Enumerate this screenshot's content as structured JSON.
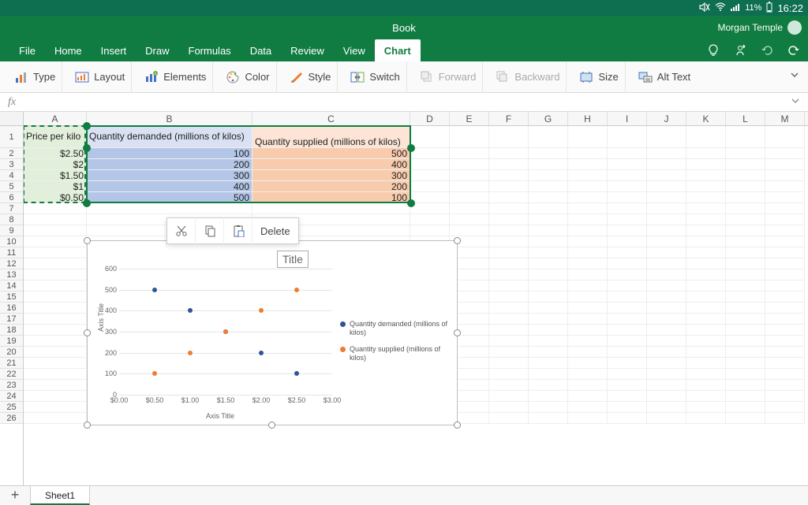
{
  "status": {
    "battery": "11%",
    "time": "16:22"
  },
  "titlebar": {
    "title": "Book",
    "user": "Morgan Temple"
  },
  "tabs": {
    "file": "File",
    "home": "Home",
    "insert": "Insert",
    "draw": "Draw",
    "formulas": "Formulas",
    "data": "Data",
    "review": "Review",
    "view": "View",
    "chart": "Chart"
  },
  "ribbon": {
    "type": "Type",
    "layout": "Layout",
    "elements": "Elements",
    "color": "Color",
    "style": "Style",
    "switch": "Switch",
    "forward": "Forward",
    "backward": "Backward",
    "size": "Size",
    "alttext": "Alt Text"
  },
  "columns": [
    "A",
    "B",
    "C",
    "D",
    "E",
    "F",
    "G",
    "H",
    "I",
    "J",
    "K",
    "L",
    "M"
  ],
  "sheet": {
    "header_row": {
      "A": "Price per kilo",
      "B": "Quantity demanded (millions of kilos)",
      "C": "Quantity supplied (millions of kilos)"
    },
    "rows": [
      {
        "A": "$2.50",
        "B": "100",
        "C": "500"
      },
      {
        "A": "$2",
        "B": "200",
        "C": "400"
      },
      {
        "A": "$1.50",
        "B": "300",
        "C": "300"
      },
      {
        "A": "$1",
        "B": "400",
        "C": "200"
      },
      {
        "A": "$0.50",
        "B": "500",
        "C": "100"
      }
    ]
  },
  "context_menu": {
    "delete": "Delete"
  },
  "chart": {
    "title_placeholder": "Title",
    "xaxis": "Axis Title",
    "yaxis": "Axis Title",
    "legend_demand": "Quantity demanded (millions of kilos)",
    "legend_supply": "Quantity supplied (millions of kilos)",
    "yticks": [
      "0",
      "100",
      "200",
      "300",
      "400",
      "500",
      "600"
    ],
    "xticks": [
      "$0.00",
      "$0.50",
      "$1.00",
      "$1.50",
      "$2.00",
      "$2.50",
      "$3.00"
    ]
  },
  "chart_data": {
    "type": "scatter",
    "xlabel": "Axis Title",
    "ylabel": "Axis Title",
    "xlim": [
      0,
      3
    ],
    "ylim": [
      0,
      600
    ],
    "series": [
      {
        "name": "Quantity demanded (millions of kilos)",
        "color": "#2f5597",
        "points": [
          {
            "x": 2.5,
            "y": 100
          },
          {
            "x": 2.0,
            "y": 200
          },
          {
            "x": 1.5,
            "y": 300
          },
          {
            "x": 1.0,
            "y": 400
          },
          {
            "x": 0.5,
            "y": 500
          }
        ]
      },
      {
        "name": "Quantity supplied (millions of kilos)",
        "color": "#ed7d31",
        "points": [
          {
            "x": 2.5,
            "y": 500
          },
          {
            "x": 2.0,
            "y": 400
          },
          {
            "x": 1.5,
            "y": 300
          },
          {
            "x": 1.0,
            "y": 200
          },
          {
            "x": 0.5,
            "y": 100
          }
        ]
      }
    ]
  },
  "sheets": {
    "sheet1": "Sheet1"
  }
}
